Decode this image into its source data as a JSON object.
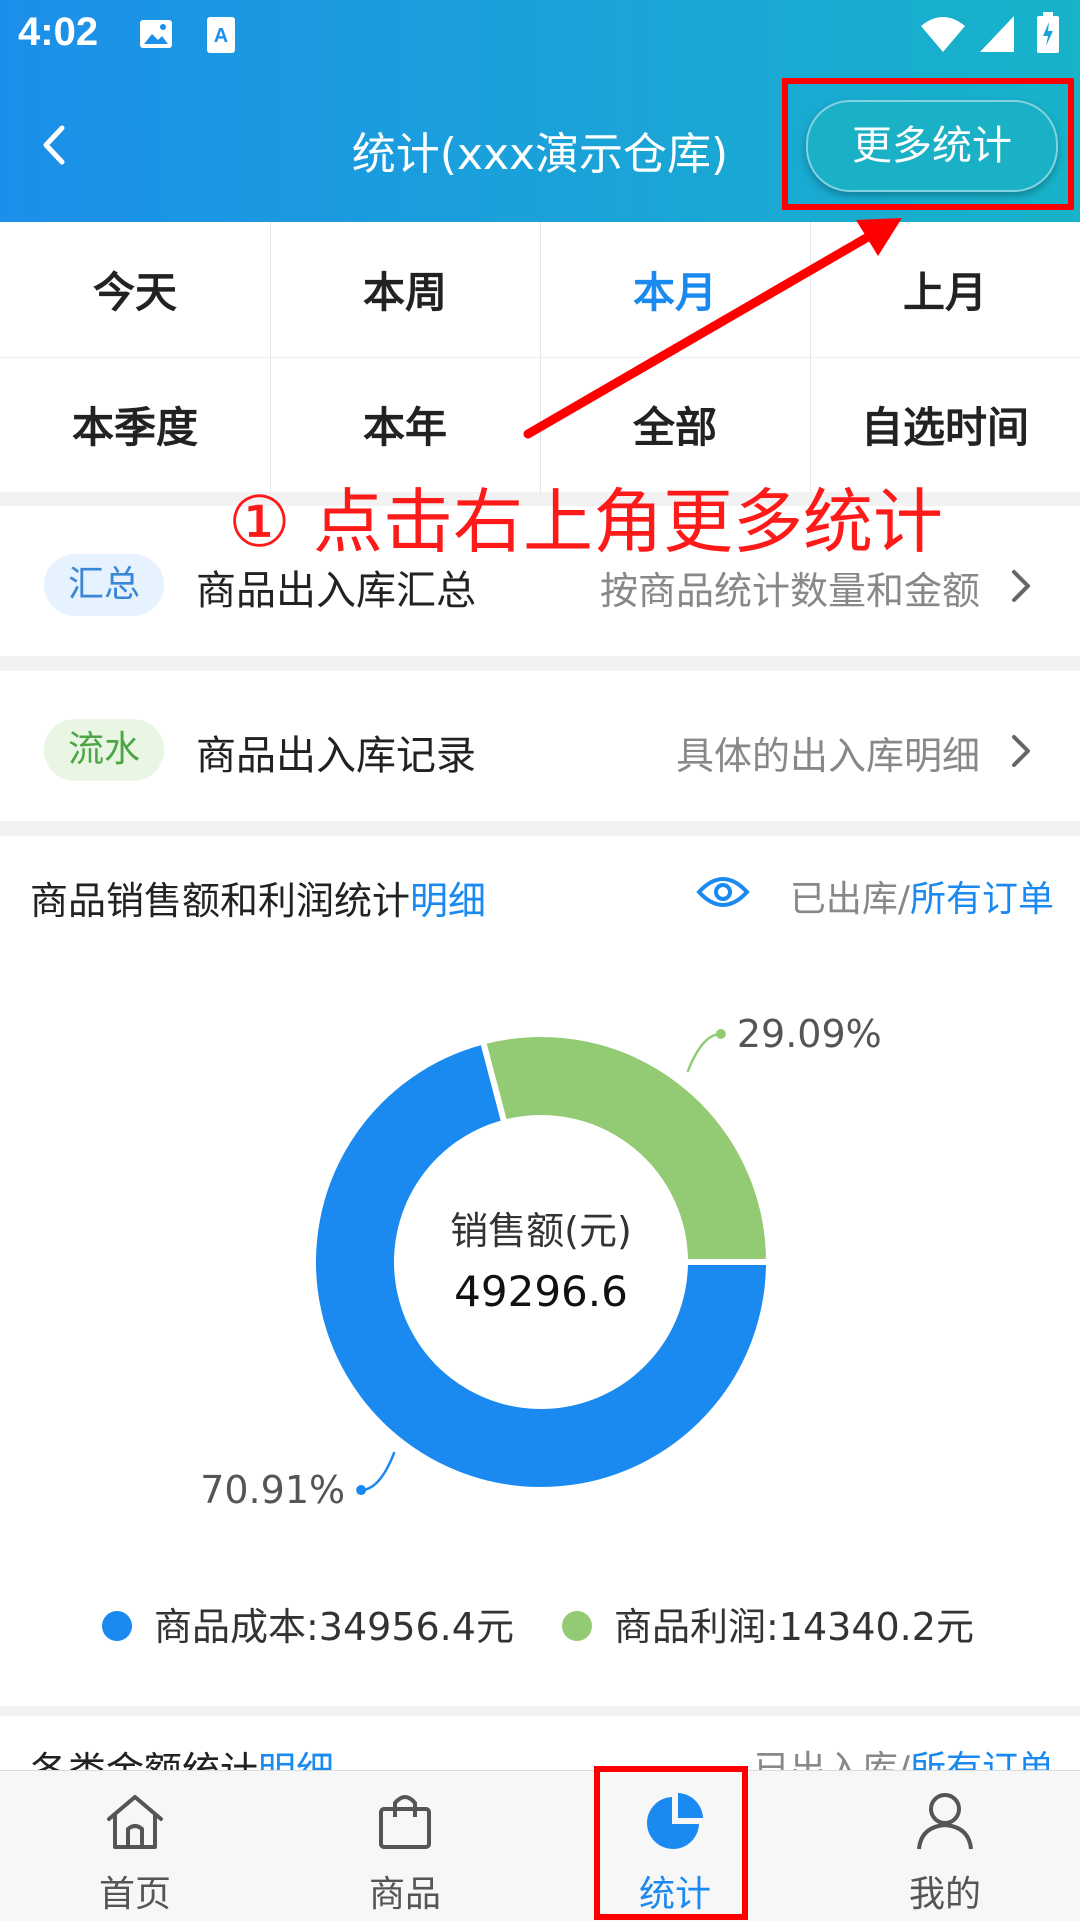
{
  "status_bar": {
    "time": "4:02"
  },
  "header": {
    "title": "统计(xxx演示仓库)",
    "more_button": "更多统计"
  },
  "filters": [
    {
      "label": "今天",
      "active": false
    },
    {
      "label": "本周",
      "active": false
    },
    {
      "label": "本月",
      "active": true
    },
    {
      "label": "上月",
      "active": false
    },
    {
      "label": "本季度",
      "active": false
    },
    {
      "label": "本年",
      "active": false
    },
    {
      "label": "全部",
      "active": false
    },
    {
      "label": "自选时间",
      "active": false
    }
  ],
  "annotation": "① 点击右上角更多统计",
  "rows": [
    {
      "tag": "汇总",
      "title": "商品出入库汇总",
      "desc": "按商品统计数量和金额"
    },
    {
      "tag": "流水",
      "title": "商品出入库记录",
      "desc": "具体的出入库明细"
    }
  ],
  "sales_card": {
    "title": "商品销售额和利润统计",
    "detail_link": "明细",
    "filter_left": "已出库/",
    "filter_right": "所有订单",
    "center_label": "销售额(元)",
    "center_value": "49296.6",
    "legend_cost": "商品成本:34956.4元",
    "legend_profit": "商品利润:14340.2元"
  },
  "chart_data": {
    "type": "pie",
    "donut": true,
    "slices": [
      {
        "name": "商品成本",
        "value": 34956.4,
        "percent": "70.91%",
        "color": "#1a8af0"
      },
      {
        "name": "商品利润",
        "value": 14340.2,
        "percent": "29.09%",
        "color": "#92cb73"
      }
    ],
    "total_label": "销售额(元)",
    "total": 49296.6
  },
  "second_card": {
    "title": "各类金额统计",
    "detail_link": "明细",
    "filter_left": "已出入库/",
    "filter_right": "所有订单"
  },
  "tabbar": [
    {
      "label": "首页",
      "icon": "home-icon",
      "active": false
    },
    {
      "label": "商品",
      "icon": "shopping-bag-icon",
      "active": false
    },
    {
      "label": "统计",
      "icon": "pie-chart-icon",
      "active": true
    },
    {
      "label": "我的",
      "icon": "user-icon",
      "active": false
    }
  ],
  "colors": {
    "accent": "#1a8af0",
    "profit": "#92cb73",
    "annotation": "#ff0000"
  }
}
